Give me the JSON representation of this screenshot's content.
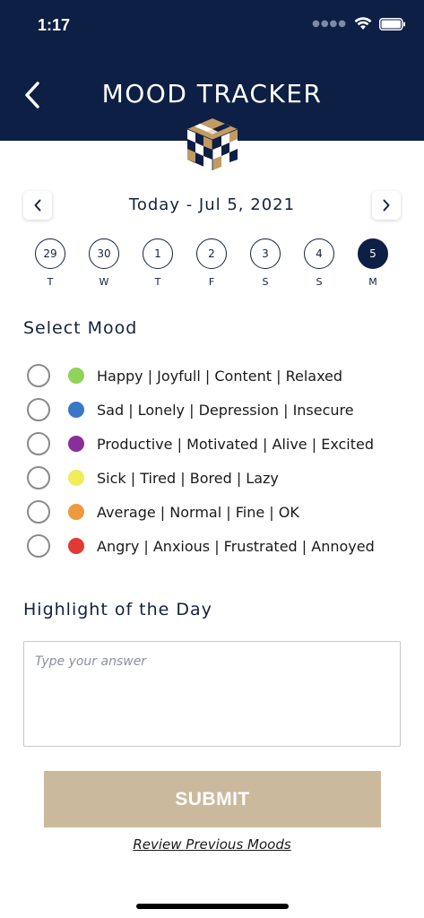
{
  "status_bar": {
    "time": "1:17",
    "signal_icon": "cellular-dots-icon",
    "wifi_icon": "wifi-icon",
    "battery_icon": "battery-icon"
  },
  "header": {
    "title": "MOOD TRACKER",
    "back_icon": "chevron-left-icon",
    "background_color": "#0e1f45"
  },
  "date_nav": {
    "label": "Today - Jul 5, 2021",
    "prev_icon": "chevron-left-icon",
    "next_icon": "chevron-right-icon"
  },
  "days": [
    {
      "num": "29",
      "letter": "T"
    },
    {
      "num": "30",
      "letter": "W"
    },
    {
      "num": "1",
      "letter": "T"
    },
    {
      "num": "2",
      "letter": "F"
    },
    {
      "num": "3",
      "letter": "S"
    },
    {
      "num": "4",
      "letter": "S"
    },
    {
      "num": "5",
      "letter": "M",
      "selected": true
    }
  ],
  "mood_section": {
    "title": "Select Mood",
    "options": [
      {
        "label": "Happy | Joyfull | Content | Relaxed",
        "color": "#8fd35a"
      },
      {
        "label": "Sad | Lonely | Depression | Insecure",
        "color": "#3a77c6"
      },
      {
        "label": "Productive | Motivated | Alive | Excited",
        "color": "#8a2e9a"
      },
      {
        "label": "Sick | Tired | Bored | Lazy",
        "color": "#f1ec5a"
      },
      {
        "label": "Average | Normal | Fine | OK",
        "color": "#ec9a3a"
      },
      {
        "label": "Angry | Anxious | Frustrated | Annoyed",
        "color": "#e03a32"
      }
    ]
  },
  "highlight_section": {
    "title": "Highlight of the Day",
    "placeholder": "Type your answer"
  },
  "submit": {
    "label": "SUBMIT",
    "color": "#cbb99d"
  },
  "review_link": "Review Previous Moods"
}
